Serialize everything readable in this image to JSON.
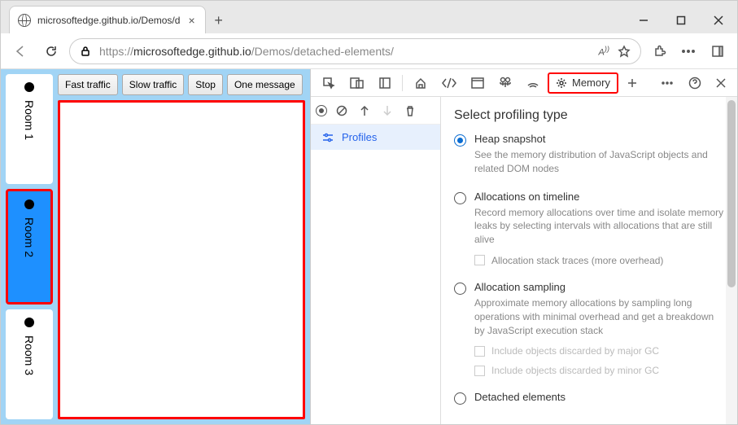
{
  "browser": {
    "tab_title": "microsoftedge.github.io/Demos/d",
    "url_host": "microsoftedge.github.io",
    "url_path": "/Demos/detached-elements/",
    "url_prefix": "https://"
  },
  "page": {
    "rooms": [
      {
        "label": "Room 1",
        "selected": false
      },
      {
        "label": "Room 2",
        "selected": true
      },
      {
        "label": "Room 3",
        "selected": false
      }
    ],
    "buttons": {
      "fast": "Fast traffic",
      "slow": "Slow traffic",
      "stop": "Stop",
      "one": "One message"
    }
  },
  "devtools": {
    "memory_tab": "Memory",
    "profiles_label": "Profiles",
    "heading": "Select profiling type",
    "options": {
      "heap": {
        "title": "Heap snapshot",
        "desc": "See the memory distribution of JavaScript objects and related DOM nodes"
      },
      "timeline": {
        "title": "Allocations on timeline",
        "desc": "Record memory allocations over time and isolate memory leaks by selecting intervals with allocations that are still alive",
        "sub": "Allocation stack traces (more overhead)"
      },
      "sampling": {
        "title": "Allocation sampling",
        "desc": "Approximate memory allocations by sampling long operations with minimal overhead and get a breakdown by JavaScript execution stack",
        "sub1": "Include objects discarded by major GC",
        "sub2": "Include objects discarded by minor GC"
      },
      "detached": {
        "title": "Detached elements"
      }
    }
  }
}
